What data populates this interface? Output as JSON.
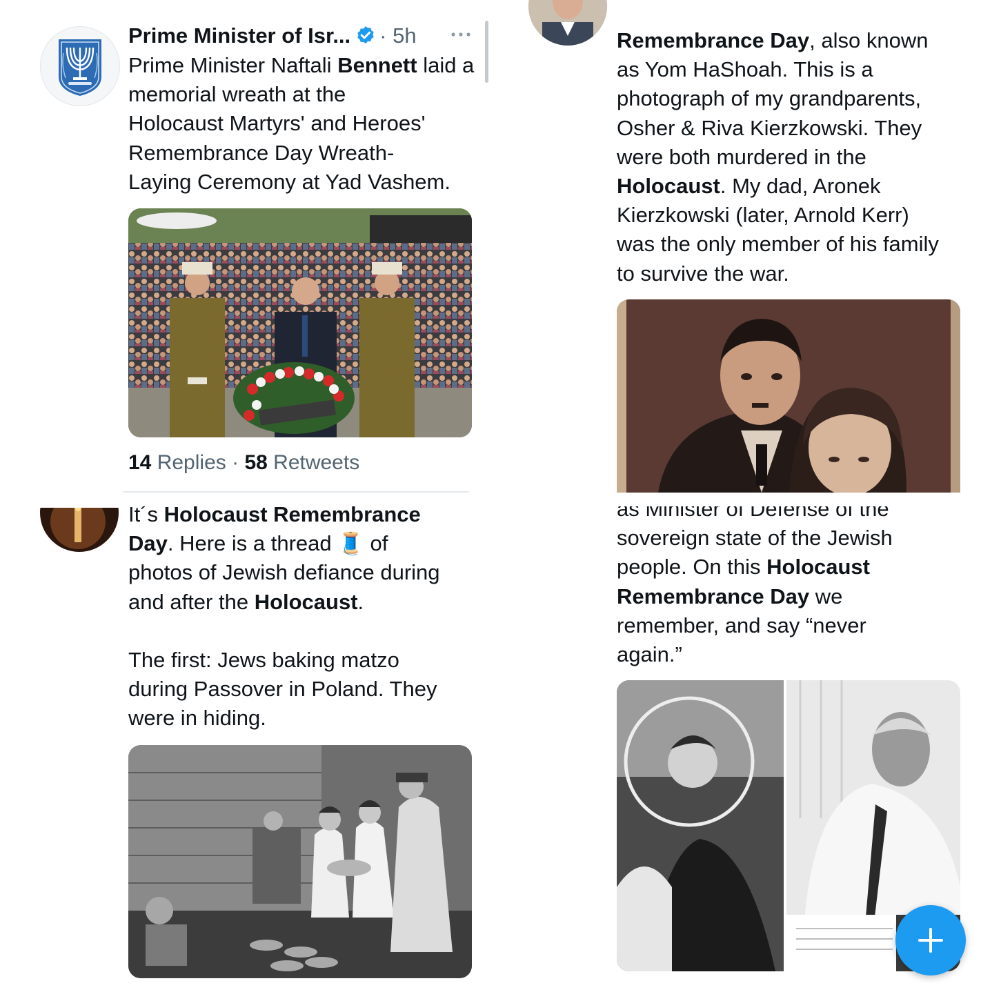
{
  "colors": {
    "accent": "#1d9bf0",
    "text": "#0f1419",
    "muted": "#536471",
    "divider": "#e6e9eb"
  },
  "tweet1": {
    "avatar_icon": "state-emblem-menorah-icon",
    "author": "Prime Minister of Isr...",
    "verified_icon": "verified-badge-icon",
    "time": "· 5h",
    "more_icon": "more-dots-icon",
    "text_parts": [
      "Prime Minister Naftali ",
      "Bennett",
      " laid a memorial wreath at the\nHolocaust Martyrs' and Heroes'\nRemembrance Day Wreath-\nLaying Ceremony at Yad Vashem."
    ],
    "image_alt": "wreath-laying ceremony photo",
    "replies_count": "14",
    "replies_label": " Replies",
    "separator": " · ",
    "retweets_count": "58",
    "retweets_label": " Retweets"
  },
  "tweet2": {
    "text_parts": [
      "Remembrance Day",
      ", also known\nas Yom HaShoah. This is a\nphotograph of my grandparents,\nOsher & Riva Kierzkowski.  They\nwere both murdered in the\n",
      "Holocaust",
      ". My dad, Aronek\nKierzkowski (later, Arnold Kerr)\nwas the only member of his family\nto survive the war."
    ],
    "image_alt": "sepia portrait of a couple"
  },
  "tweet3": {
    "text_parts": [
      "It´s ",
      "Holocaust Remembrance",
      "\n",
      "Day",
      ". Here is a thread ",
      "🧵",
      " of\nphotos of Jewish defiance during\nand after the ",
      "Holocaust",
      ".\n\nThe first: Jews baking matzo\nduring Passover in Poland. They\nwere in hiding."
    ],
    "spool_icon": "thread-spool-icon",
    "image_alt": "black and white photo of matzo baking"
  },
  "tweet4": {
    "text_parts": [
      "as Minister of Defense of the\nsovereign state of the Jewish\npeople. On this ",
      "Holocaust",
      "\n",
      "Remembrance Day",
      " we\nremember, and say “never\nagain.”"
    ],
    "image_alt": "archival photo and minister signing"
  },
  "fab": {
    "icon": "plus-icon",
    "label": "+"
  }
}
